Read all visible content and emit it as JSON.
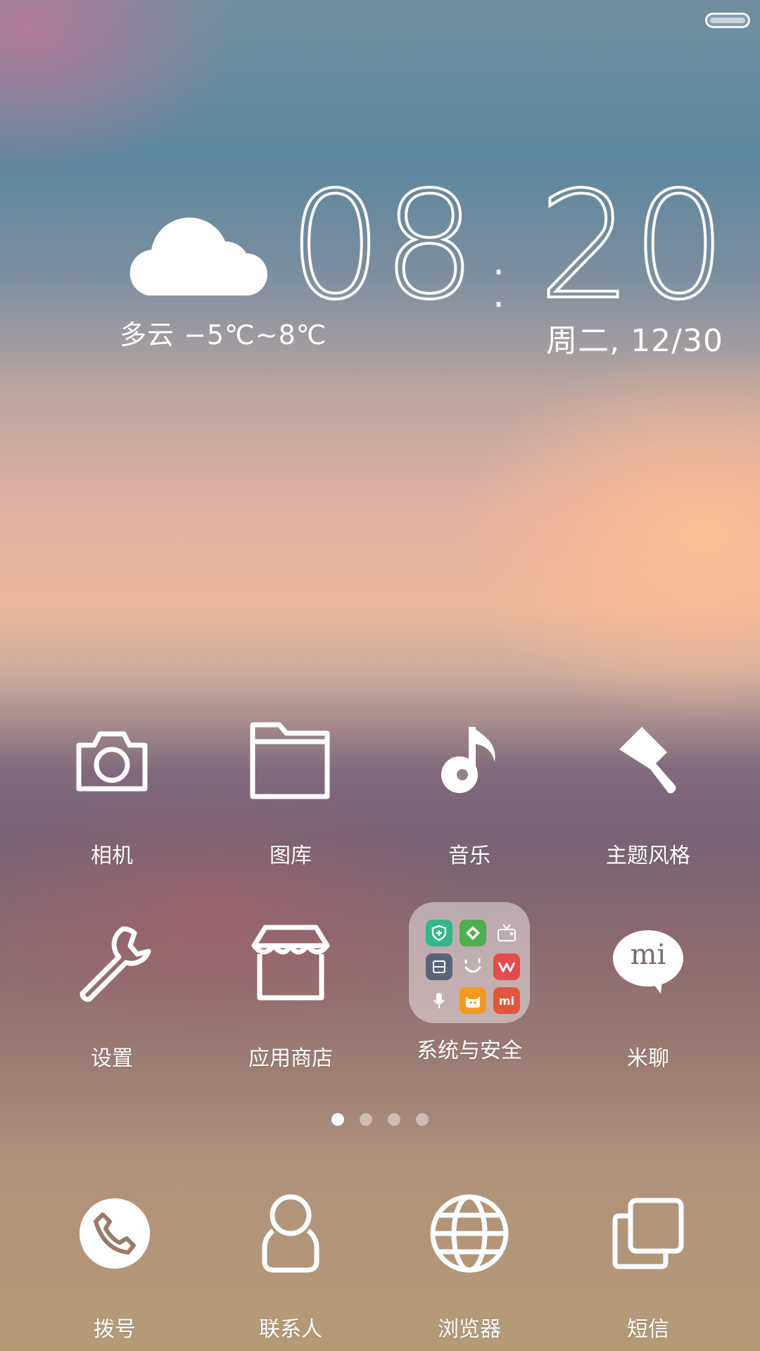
{
  "weather": {
    "icon": "cloud-icon",
    "text": "多云 −5℃~8℃"
  },
  "clock": {
    "hours": "08",
    "separator": ":",
    "minutes": "20"
  },
  "date": "周二, 12/30",
  "apps_row1": [
    {
      "label": "相机",
      "icon": "camera-icon"
    },
    {
      "label": "图库",
      "icon": "folder-icon"
    },
    {
      "label": "音乐",
      "icon": "music-note-icon"
    },
    {
      "label": "主题风格",
      "icon": "paintbrush-icon"
    }
  ],
  "apps_row2": [
    {
      "label": "设置",
      "icon": "wrench-icon"
    },
    {
      "label": "应用商店",
      "icon": "store-icon"
    },
    {
      "label": "系统与安全",
      "icon": "folder-group-icon"
    },
    {
      "label": "米聊",
      "icon": "chat-bubble-icon",
      "text": "mi"
    }
  ],
  "folder_icons": [
    {
      "icon": "shield-icon",
      "color": "#2fb98a"
    },
    {
      "icon": "diamond-icon",
      "color": "#4caf50"
    },
    {
      "icon": "tv-icon",
      "color": "transparent"
    },
    {
      "icon": "scanner-icon",
      "color": "#5a6478"
    },
    {
      "icon": "smile-icon",
      "color": "transparent"
    },
    {
      "icon": "wps-icon",
      "color": "#e64b4b"
    },
    {
      "icon": "mic-icon",
      "color": "transparent"
    },
    {
      "icon": "mitu-icon",
      "color": "#f39a1e"
    },
    {
      "icon": "mi-icon",
      "color": "#e2563b",
      "text": "mi"
    }
  ],
  "page_indicator": {
    "count": 4,
    "active": 0
  },
  "dock": [
    {
      "label": "拨号",
      "icon": "phone-icon"
    },
    {
      "label": "联系人",
      "icon": "contact-icon"
    },
    {
      "label": "浏览器",
      "icon": "globe-icon"
    },
    {
      "label": "短信",
      "icon": "messages-icon"
    }
  ]
}
